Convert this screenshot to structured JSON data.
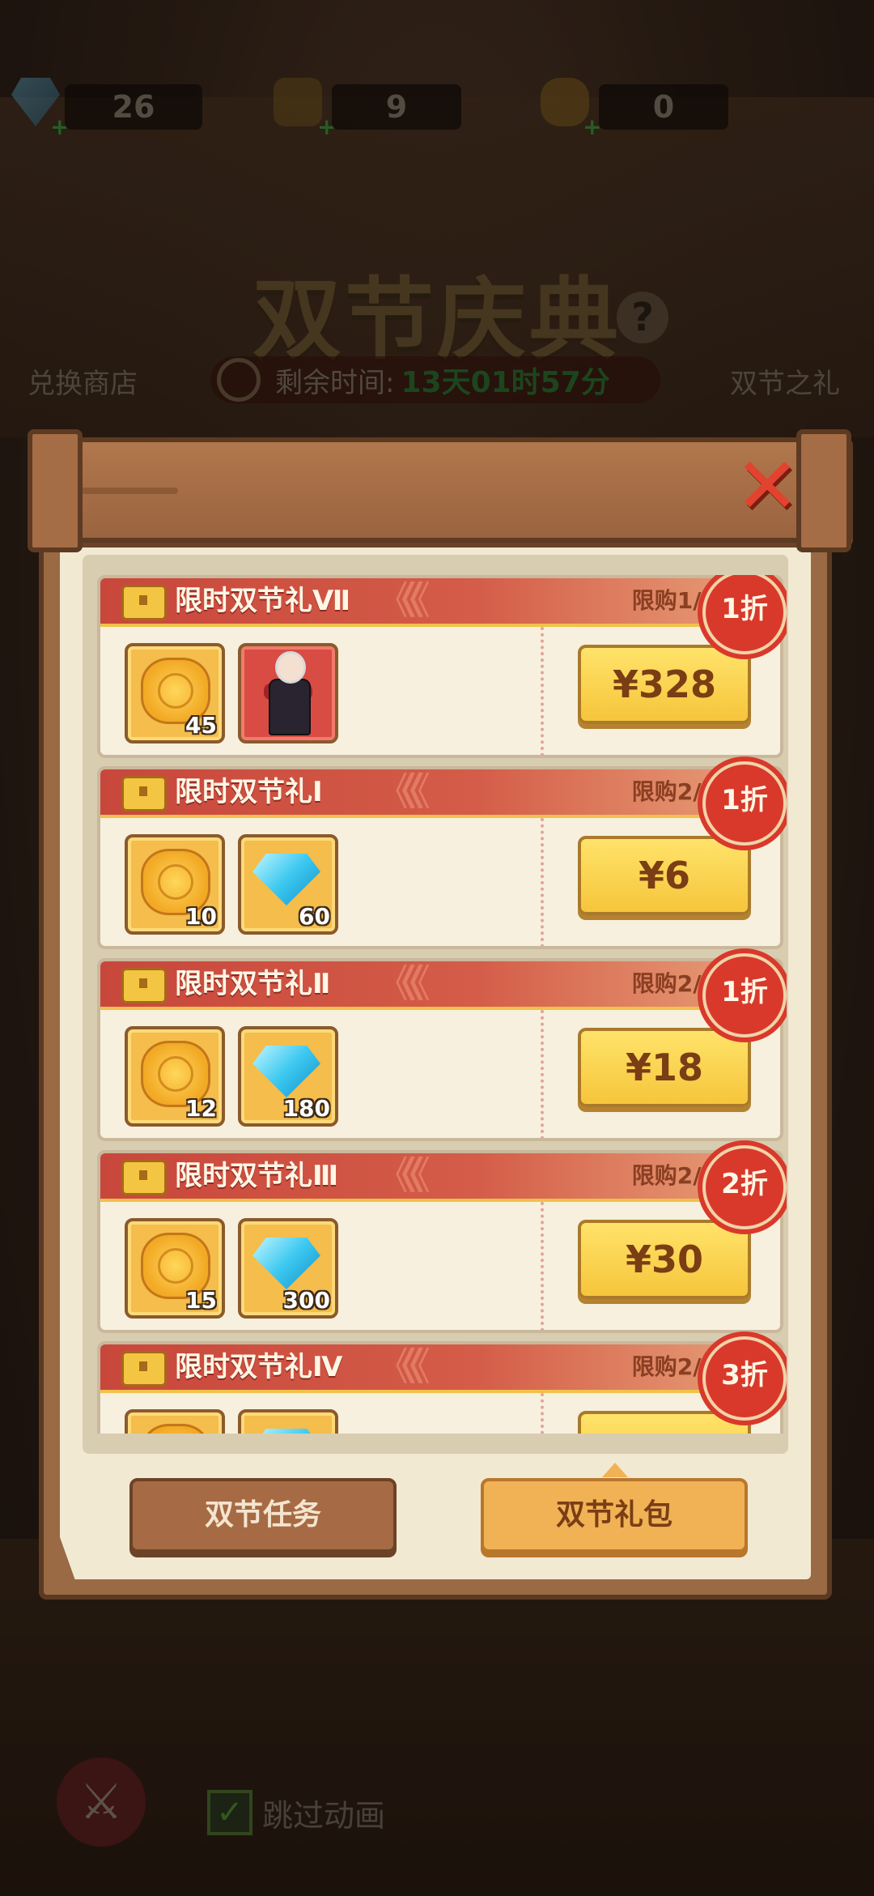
{
  "background": {
    "resources": [
      {
        "icon": "diamond-icon",
        "value": "26"
      },
      {
        "icon": "lantern-icon",
        "value": "9"
      },
      {
        "icon": "mooncake-icon",
        "value": "0"
      }
    ],
    "title": "双节庆典",
    "help": "?",
    "exchange_shop": "兑换商店",
    "gift_label": "双节之礼",
    "timer_label": "剩余时间:",
    "timer_value": "13天01时57分",
    "skip_animation": "跳过动画"
  },
  "modal": {
    "close": "✕",
    "packs": [
      {
        "title": "限时双节礼Ⅶ",
        "limit": "限购1/1",
        "discount": "1折",
        "price": "¥328",
        "items": [
          {
            "icon": "mooncake-icon",
            "count": "45"
          },
          {
            "icon": "hero-icon",
            "count": ""
          }
        ]
      },
      {
        "title": "限时双节礼Ⅰ",
        "limit": "限购2/2",
        "discount": "1折",
        "price": "¥6",
        "items": [
          {
            "icon": "mooncake-icon",
            "count": "10"
          },
          {
            "icon": "diamond-icon",
            "count": "60"
          }
        ]
      },
      {
        "title": "限时双节礼Ⅱ",
        "limit": "限购2/2",
        "discount": "1折",
        "price": "¥18",
        "items": [
          {
            "icon": "mooncake-icon",
            "count": "12"
          },
          {
            "icon": "diamond-icon",
            "count": "180"
          }
        ]
      },
      {
        "title": "限时双节礼Ⅲ",
        "limit": "限购2/2",
        "discount": "2折",
        "price": "¥30",
        "items": [
          {
            "icon": "mooncake-icon",
            "count": "15"
          },
          {
            "icon": "diamond-icon",
            "count": "300"
          }
        ]
      },
      {
        "title": "限时双节礼Ⅳ",
        "limit": "限购2/2",
        "discount": "3折",
        "price": "",
        "items": [
          {
            "icon": "mooncake-icon",
            "count": ""
          },
          {
            "icon": "diamond-icon",
            "count": ""
          }
        ]
      }
    ],
    "tabs": {
      "task": "双节任务",
      "gift": "双节礼包"
    }
  },
  "colors": {
    "accent_red": "#d8392b",
    "price_yellow": "#f6c53b",
    "paper": "#f2e9d2",
    "wood": "#9a6a45"
  }
}
